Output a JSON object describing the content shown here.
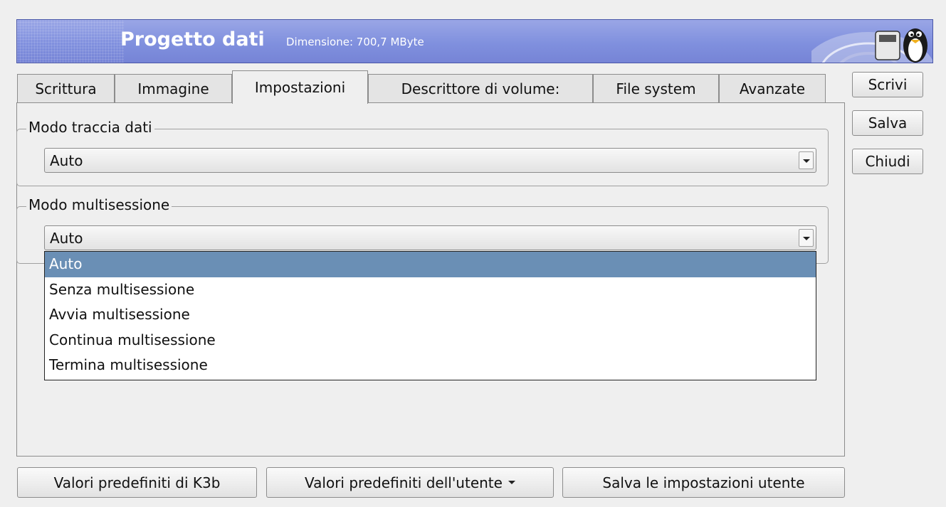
{
  "banner": {
    "title": "Progetto dati",
    "size_text": "Dimensione: 700,7 MByte"
  },
  "tabs": [
    {
      "label": "Scrittura"
    },
    {
      "label": "Immagine"
    },
    {
      "label": "Impostazioni",
      "active": true
    },
    {
      "label": "Descrittore di volume:"
    },
    {
      "label": "File system"
    },
    {
      "label": "Avanzate"
    }
  ],
  "data_track_mode": {
    "label": "Modo traccia dati",
    "value": "Auto"
  },
  "multisession_mode": {
    "label": "Modo multisessione",
    "value": "Auto",
    "options": [
      {
        "label": "Auto",
        "selected": true
      },
      {
        "label": "Senza multisessione"
      },
      {
        "label": "Avvia multisessione"
      },
      {
        "label": "Continua multisessione"
      },
      {
        "label": "Termina multisessione"
      }
    ]
  },
  "side_buttons": {
    "write": "Scrivi",
    "save": "Salva",
    "close": "Chiudi"
  },
  "bottom_buttons": {
    "k3b_defaults": "Valori predefiniti di K3b",
    "user_defaults": "Valori predefiniti dell'utente",
    "save_user_settings": "Salva le impostazioni utente"
  },
  "colors": {
    "banner": "#8090de",
    "selection": "#6a8fb5"
  },
  "icons": {
    "banner_logo": "k3b-penguin-disc-icon",
    "combo_arrow": "chevron-down-icon",
    "menu_caret": "caret-down-icon"
  }
}
